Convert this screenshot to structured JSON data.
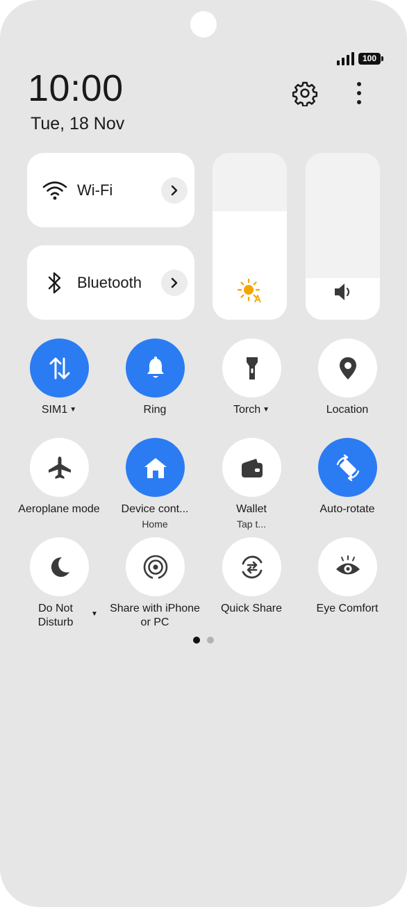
{
  "status_bar": {
    "battery": "100"
  },
  "header": {
    "time": "10:00",
    "date": "Tue, 18 Nov"
  },
  "tiles": [
    {
      "label": "Wi-Fi",
      "icon": "wifi-icon"
    },
    {
      "label": "Bluetooth",
      "icon": "bluetooth-icon"
    }
  ],
  "sliders": {
    "brightness": {
      "level_percent": 65,
      "icon": "brightness-auto-icon"
    },
    "volume": {
      "level_percent": 25,
      "icon": "speaker-icon"
    }
  },
  "quick_settings": [
    {
      "label": "SIM1",
      "icon": "data-transfer-icon",
      "active": true,
      "has_caret": true
    },
    {
      "label": "Ring",
      "icon": "bell-icon",
      "active": true
    },
    {
      "label": "Torch",
      "icon": "flashlight-icon",
      "active": false,
      "has_caret": true
    },
    {
      "label": "Location",
      "icon": "location-pin-icon",
      "active": false
    },
    {
      "label": "Aeroplane mode",
      "icon": "airplane-icon",
      "active": false
    },
    {
      "label": "Device cont...",
      "sublabel": "Home",
      "icon": "home-icon",
      "active": true
    },
    {
      "label": "Wallet",
      "sublabel": "Tap t...",
      "icon": "wallet-icon",
      "active": false
    },
    {
      "label": "Auto-rotate",
      "icon": "rotate-icon",
      "active": true
    },
    {
      "label": "Do Not Disturb",
      "icon": "moon-icon",
      "active": false,
      "has_caret": true
    },
    {
      "label": "Share with iPhone or PC",
      "icon": "share-signal-icon",
      "active": false
    },
    {
      "label": "Quick Share",
      "icon": "quick-share-icon",
      "active": false
    },
    {
      "label": "Eye Comfort",
      "icon": "eye-icon",
      "active": false
    }
  ],
  "pager": {
    "pages": 2,
    "current": 1
  },
  "colors": {
    "accent": "#2b7cf2",
    "background": "#e6e6e6",
    "tile": "#ffffff",
    "brightness_icon": "#f5a500"
  }
}
